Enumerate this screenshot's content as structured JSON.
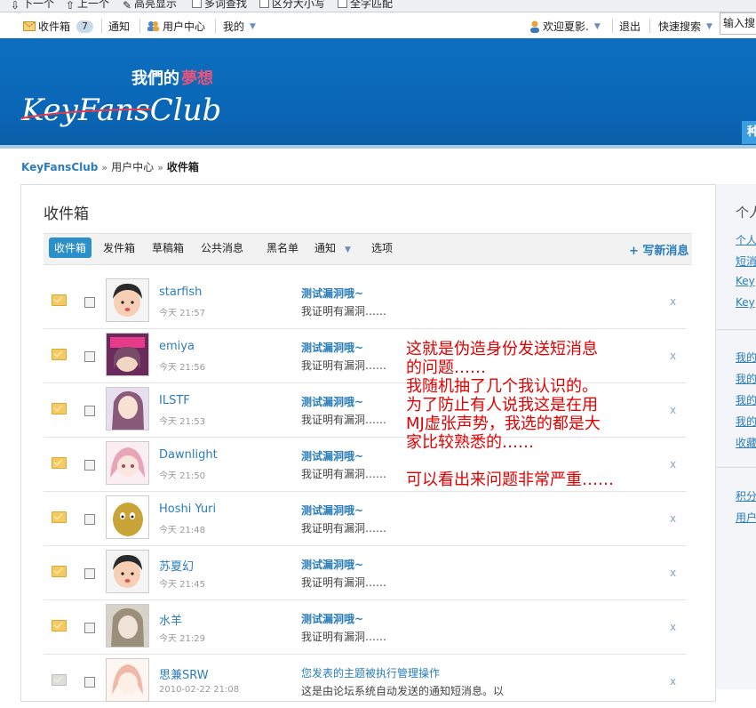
{
  "findbar": {
    "next": "下一个",
    "prev": "上一个",
    "highlight": "高亮显示",
    "multi_word": "多词查找",
    "match_case": "区分大小写",
    "whole_word": "全字匹配"
  },
  "toolbar": {
    "inbox_label": "收件箱",
    "inbox_count": "7",
    "notify_label": "通知",
    "user_center_label": "用户中心",
    "mine_label": "我的",
    "welcome_label": "欢迎夏影.",
    "logout_label": "退出",
    "quick_search_label": "快速搜索",
    "search_placeholder": "输入搜"
  },
  "banner": {
    "logo_top": "我們的夢想",
    "logo_main": "KeyFansClub",
    "tab_char": "种"
  },
  "breadcrumb": {
    "home": "KeyFansClub",
    "sep1": "»",
    "level1": "用户中心",
    "sep2": "»",
    "current": "收件箱"
  },
  "panel": {
    "title": "收件箱",
    "tabs": [
      "收件箱",
      "发件箱",
      "草稿箱",
      "公共消息",
      "黑名单",
      "通知",
      "选项"
    ],
    "compose_label": "+ 写新消息"
  },
  "messages": [
    {
      "name": "starfish",
      "time": "今天 21:57",
      "subject": "测试漏洞哦~",
      "preview": "我证明有漏洞……",
      "read": false
    },
    {
      "name": "emiya",
      "time": "今天 21:56",
      "subject": "测试漏洞哦~",
      "preview": "我证明有漏洞……",
      "read": false
    },
    {
      "name": "ILSTF",
      "time": "今天 21:53",
      "subject": "测试漏洞哦~",
      "preview": "我证明有漏洞……",
      "read": false
    },
    {
      "name": "Dawnlight",
      "time": "今天 21:50",
      "subject": "测试漏洞哦~",
      "preview": "我证明有漏洞……",
      "read": false
    },
    {
      "name": "Hoshi Yuri",
      "time": "今天 21:48",
      "subject": "测试漏洞哦~",
      "preview": "我证明有漏洞……",
      "read": false
    },
    {
      "name": "苏夏幻",
      "time": "今天 21:45",
      "subject": "测试漏洞哦~",
      "preview": "我证明有漏洞……",
      "read": false
    },
    {
      "name": "水羊",
      "time": "今天 21:29",
      "subject": "测试漏洞哦~",
      "preview": "我证明有漏洞……",
      "read": false
    },
    {
      "name": "思兼SRW",
      "time": "2010-02-22 21:08",
      "subject": "您发表的主题被执行管理操作",
      "preview": "这是由论坛系统自动发送的通知短消息。以",
      "read": true
    }
  ],
  "delete_label": "x",
  "annotation": [
    "这就是伪造身份发送短消息",
    "的问题……",
    "我随机抽了几个我认识的。",
    "为了防止有人说我这是在用",
    "MJ虚张声势，我选的都是大",
    "家比较熟悉的……",
    "",
    "可以看出来问题非常严重……"
  ],
  "sidebar": {
    "header": "个人",
    "group1": [
      "个人",
      "短消",
      "Key",
      "Key"
    ],
    "group2": [
      "我的",
      "我的",
      "我的",
      "我的",
      "收藏"
    ],
    "group3": [
      "积分",
      "用户"
    ]
  },
  "colors": {
    "banner": "#0d6fc0",
    "link": "#2a7db8",
    "active_tab": "#2b8fc9",
    "annotation": "#e30000"
  }
}
